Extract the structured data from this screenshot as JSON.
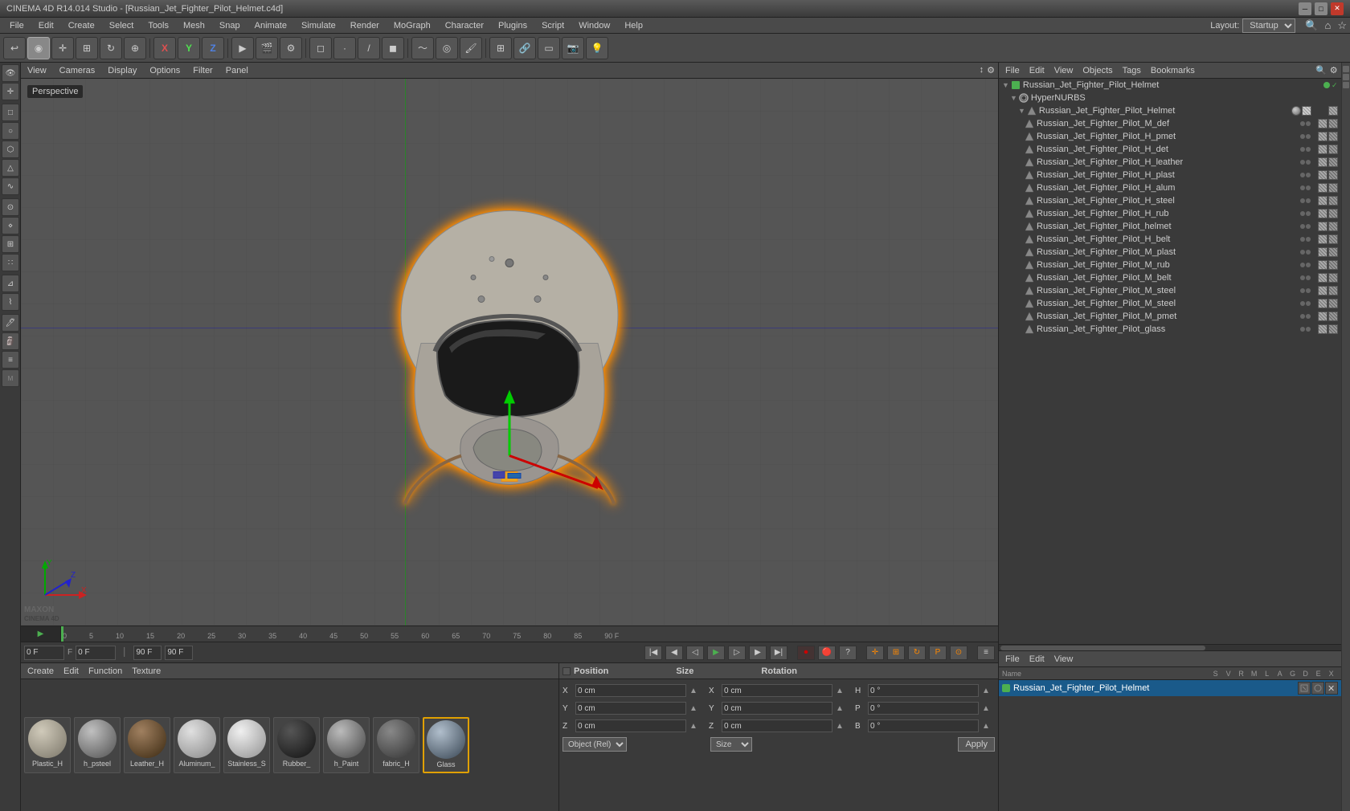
{
  "titlebar": {
    "title": "CINEMA 4D R14.014 Studio - [Russian_Jet_Fighter_Pilot_Helmet.c4d]"
  },
  "menubar": {
    "items": [
      "File",
      "Edit",
      "Create",
      "Select",
      "Tools",
      "Mesh",
      "Snap",
      "Animate",
      "Simulate",
      "Render",
      "MoGraph",
      "Character",
      "Plugins",
      "Script",
      "Window",
      "Help"
    ],
    "layout_label": "Layout:",
    "layout_value": "Startup"
  },
  "viewport": {
    "label": "Perspective",
    "menus": [
      "View",
      "Cameras",
      "Display",
      "Options",
      "Filter",
      "Panel"
    ]
  },
  "right_panel": {
    "menus": [
      "File",
      "Edit",
      "View",
      "Objects",
      "Tags",
      "Bookmarks"
    ],
    "root_object": "Russian_Jet_Fighter_Pilot_Helmet",
    "hyper_nurbs": "HyperNURBS",
    "objects": [
      "Russian_Jet_Fighter_Pilot_Helmet",
      "Russian_Jet_Fighter_Pilot_M_def",
      "Russian_Jet_Fighter_Pilot_H_pmet",
      "Russian_Jet_Fighter_Pilot_H_det",
      "Russian_Jet_Fighter_Pilot_H_leather",
      "Russian_Jet_Fighter_Pilot_H_plast",
      "Russian_Jet_Fighter_Pilot_H_alum",
      "Russian_Jet_Fighter_Pilot_H_steel",
      "Russian_Jet_Fighter_Pilot_H_rub",
      "Russian_Jet_Fighter_Pilot_helmet",
      "Russian_Jet_Fighter_Pilot_H_belt",
      "Russian_Jet_Fighter_Pilot_M_plast",
      "Russian_Jet_Fighter_Pilot_M_rub",
      "Russian_Jet_Fighter_Pilot_M_belt",
      "Russian_Jet_Fighter_Pilot_M_steel",
      "Russian_Jet_Fighter_Pilot_M_steel",
      "Russian_Jet_Fighter_Pilot_M_pmet",
      "Russian_Jet_Fighter_Pilot_glass"
    ]
  },
  "bottom_panel": {
    "file_menu": "File",
    "edit_menu": "Edit",
    "view_menu": "View",
    "properties": {
      "name_label": "Name",
      "name_value": "Russian_Jet_Fighter_Pilot_Helmet",
      "columns": [
        "S",
        "V",
        "R",
        "M",
        "L",
        "A",
        "G",
        "D",
        "E",
        "X"
      ]
    }
  },
  "material_editor": {
    "menus": [
      "Create",
      "Edit",
      "Function",
      "Texture"
    ],
    "materials": [
      {
        "name": "Plastic_H",
        "color": "#b0a890"
      },
      {
        "name": "h_psteel",
        "color": "#888888"
      },
      {
        "name": "Leather_H",
        "color": "#7a6855"
      },
      {
        "name": "Aluminum_",
        "color": "#c0c0c0"
      },
      {
        "name": "Stainless_S",
        "color": "#d0d0d0"
      },
      {
        "name": "Rubber_",
        "color": "#444444"
      },
      {
        "name": "h_Paint",
        "color": "#888888"
      },
      {
        "name": "fabric_H",
        "color": "#666666"
      },
      {
        "name": "Glass",
        "color": "#88aacc",
        "selected": true
      }
    ]
  },
  "transform": {
    "position_label": "Position",
    "size_label": "Size",
    "rotation_label": "Rotation",
    "x_label": "X",
    "y_label": "Y",
    "z_label": "Z",
    "h_label": "H",
    "p_label": "P",
    "b_label": "B",
    "pos_x": "0 cm",
    "pos_y": "0 cm",
    "pos_z": "0 cm",
    "size_x": "0 cm",
    "size_y": "0 cm",
    "size_z": "0 cm",
    "rot_h": "0 °",
    "rot_p": "0 °",
    "rot_b": "0 °",
    "coord_mode": "Object (Rel)",
    "size_mode": "Size",
    "apply_label": "Apply"
  },
  "timeline": {
    "frame_start": "0 F",
    "frame_end": "90 F",
    "current_frame": "0 F",
    "markers": [
      "0",
      "5",
      "10",
      "15",
      "20",
      "25",
      "30",
      "35",
      "40",
      "45",
      "50",
      "55",
      "60",
      "65",
      "70",
      "75",
      "80",
      "85",
      "90 F"
    ]
  }
}
